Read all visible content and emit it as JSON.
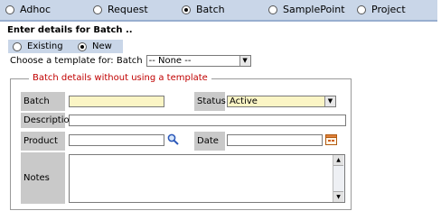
{
  "tabs": [
    {
      "label": "Adhoc",
      "selected": false
    },
    {
      "label": "Request",
      "selected": false
    },
    {
      "label": "Batch",
      "selected": true
    },
    {
      "label": "SamplePoint",
      "selected": false
    },
    {
      "label": "Project",
      "selected": false
    }
  ],
  "heading": "Enter details for Batch ..",
  "mode": {
    "existing_label": "Existing",
    "new_label": "New",
    "selected": "New"
  },
  "template": {
    "label": "Choose a template for: Batch",
    "value": "-- None --"
  },
  "form": {
    "legend": "Batch details without using a template",
    "batch_label": "Batch",
    "batch_value": "",
    "status_label": "Status",
    "status_value": "Active",
    "description_label": "Description",
    "description_value": "",
    "product_label": "Product",
    "product_value": "",
    "date_label": "Date",
    "date_value": "",
    "notes_label": "Notes",
    "notes_value": ""
  },
  "icons": {
    "product_search": "search-icon",
    "date_picker": "calendar-icon"
  },
  "colors": {
    "tab_bar": "#c9d6e8",
    "label_cell": "#c9c9c9",
    "required_field": "#fbf5c5",
    "legend": "#c00000"
  }
}
